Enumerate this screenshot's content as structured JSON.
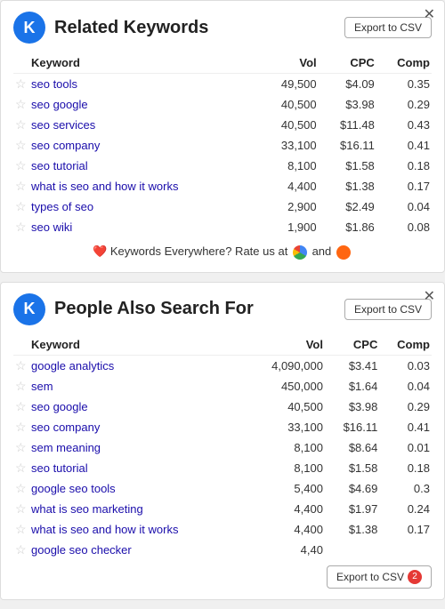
{
  "widget1": {
    "title": "Related Keywords",
    "export_label": "Export to CSV",
    "close_icon": "✕",
    "columns": [
      "",
      "Keyword",
      "Vol",
      "CPC",
      "Comp"
    ],
    "rows": [
      {
        "keyword": "seo tools",
        "vol": "49,500",
        "cpc": "$4.09",
        "comp": "0.35"
      },
      {
        "keyword": "seo google",
        "vol": "40,500",
        "cpc": "$3.98",
        "comp": "0.29"
      },
      {
        "keyword": "seo services",
        "vol": "40,500",
        "cpc": "$11.48",
        "comp": "0.43"
      },
      {
        "keyword": "seo company",
        "vol": "33,100",
        "cpc": "$16.11",
        "comp": "0.41"
      },
      {
        "keyword": "seo tutorial",
        "vol": "8,100",
        "cpc": "$1.58",
        "comp": "0.18"
      },
      {
        "keyword": "what is seo and how it works",
        "vol": "4,400",
        "cpc": "$1.38",
        "comp": "0.17"
      },
      {
        "keyword": "types of seo",
        "vol": "2,900",
        "cpc": "$2.49",
        "comp": "0.04"
      },
      {
        "keyword": "seo wiki",
        "vol": "1,900",
        "cpc": "$1.86",
        "comp": "0.08"
      }
    ],
    "rating_text_before": "Keywords Everywhere? Rate us at",
    "rating_text_and": "and"
  },
  "widget2": {
    "title": "People Also Search For",
    "export_label": "Export to CSV",
    "close_icon": "✕",
    "columns": [
      "",
      "Keyword",
      "Vol",
      "CPC",
      "Comp"
    ],
    "rows": [
      {
        "keyword": "google analytics",
        "vol": "4,090,000",
        "cpc": "$3.41",
        "comp": "0.03"
      },
      {
        "keyword": "sem",
        "vol": "450,000",
        "cpc": "$1.64",
        "comp": "0.04"
      },
      {
        "keyword": "seo google",
        "vol": "40,500",
        "cpc": "$3.98",
        "comp": "0.29"
      },
      {
        "keyword": "seo company",
        "vol": "33,100",
        "cpc": "$16.11",
        "comp": "0.41"
      },
      {
        "keyword": "sem meaning",
        "vol": "8,100",
        "cpc": "$8.64",
        "comp": "0.01"
      },
      {
        "keyword": "seo tutorial",
        "vol": "8,100",
        "cpc": "$1.58",
        "comp": "0.18"
      },
      {
        "keyword": "google seo tools",
        "vol": "5,400",
        "cpc": "$4.69",
        "comp": "0.3"
      },
      {
        "keyword": "what is seo marketing",
        "vol": "4,400",
        "cpc": "$1.97",
        "comp": "0.24"
      },
      {
        "keyword": "what is seo and how it works",
        "vol": "4,400",
        "cpc": "$1.38",
        "comp": "0.17"
      },
      {
        "keyword": "google seo checker",
        "vol": "4,40",
        "cpc": "",
        "comp": ""
      }
    ],
    "export_badge": "2"
  }
}
